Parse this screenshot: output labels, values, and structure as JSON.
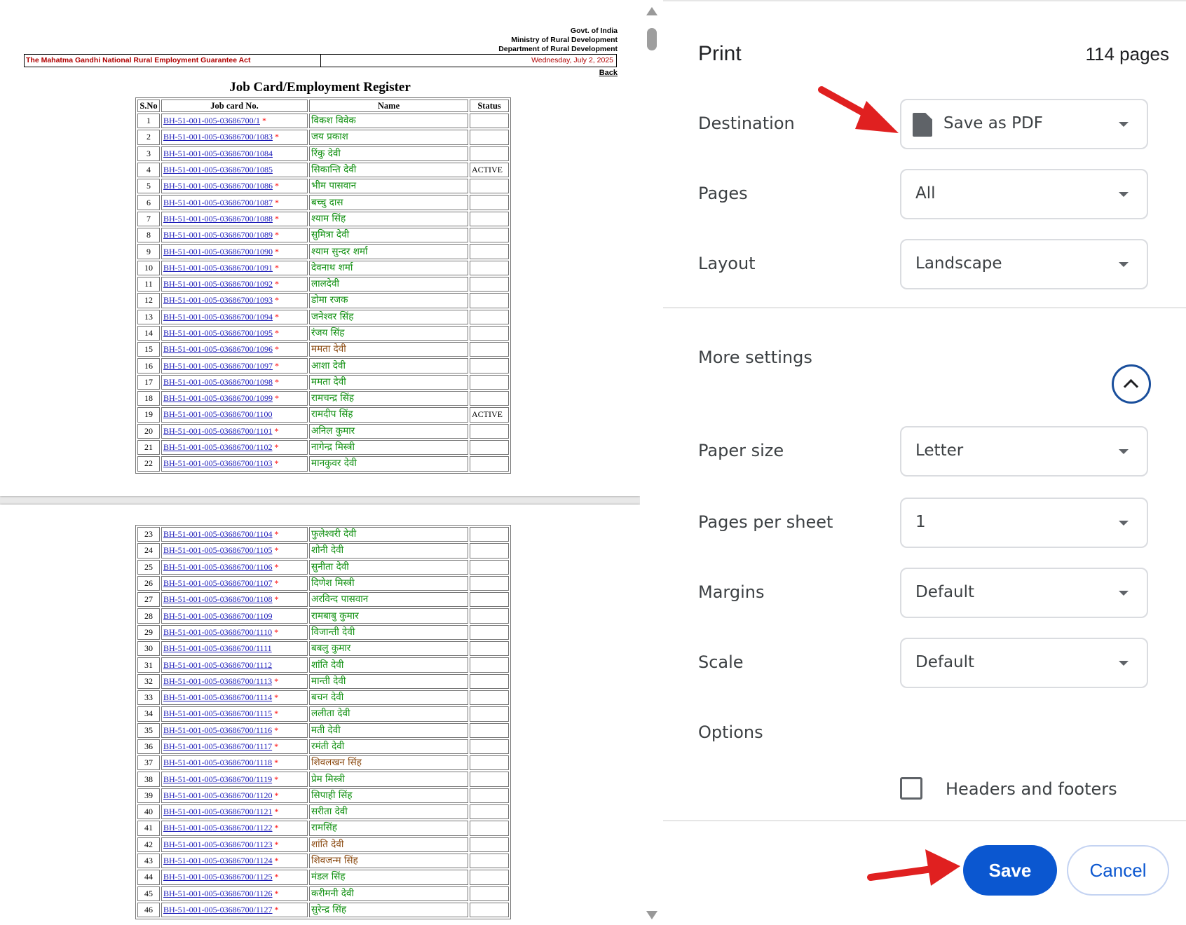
{
  "preview": {
    "header": {
      "line1": "Govt. of India",
      "line2": "Ministry of Rural Development",
      "line3": "Department of Rural Development",
      "act_name": "The Mahatma Gandhi National Rural Employment Guarantee Act",
      "date": "Wednesday, July 2, 2025",
      "back": "Back"
    },
    "register_title": "Job Card/Employment Register",
    "columns": [
      "S.No",
      "Job card No.",
      "Name",
      "Status"
    ],
    "rows": [
      {
        "sno": "1",
        "job_card": "BH-51-001-005-03686700/1",
        "star": true,
        "name": "विकश विवेक",
        "status": ""
      },
      {
        "sno": "2",
        "job_card": "BH-51-001-005-03686700/1083",
        "star": true,
        "name": "जय प्रकाश",
        "status": ""
      },
      {
        "sno": "3",
        "job_card": "BH-51-001-005-03686700/1084",
        "star": false,
        "name": "रिंकु देवी",
        "status": ""
      },
      {
        "sno": "4",
        "job_card": "BH-51-001-005-03686700/1085",
        "star": false,
        "name": "सिकान्ति देवी",
        "status": "ACTIVE"
      },
      {
        "sno": "5",
        "job_card": "BH-51-001-005-03686700/1086",
        "star": true,
        "name": "भीम पासवान",
        "status": ""
      },
      {
        "sno": "6",
        "job_card": "BH-51-001-005-03686700/1087",
        "star": true,
        "name": "बच्चु दास",
        "status": ""
      },
      {
        "sno": "7",
        "job_card": "BH-51-001-005-03686700/1088",
        "star": true,
        "name": "श्याम सिंह",
        "status": ""
      },
      {
        "sno": "8",
        "job_card": "BH-51-001-005-03686700/1089",
        "star": true,
        "name": "सुमित्रा देवी",
        "status": ""
      },
      {
        "sno": "9",
        "job_card": "BH-51-001-005-03686700/1090",
        "star": true,
        "name": "श्याम सुन्दर शर्मा",
        "status": ""
      },
      {
        "sno": "10",
        "job_card": "BH-51-001-005-03686700/1091",
        "star": true,
        "name": "देवनाथ शर्मा",
        "status": ""
      },
      {
        "sno": "11",
        "job_card": "BH-51-001-005-03686700/1092",
        "star": true,
        "name": "लालदेवी",
        "status": ""
      },
      {
        "sno": "12",
        "job_card": "BH-51-001-005-03686700/1093",
        "star": true,
        "name": "डोमा रजक",
        "status": ""
      },
      {
        "sno": "13",
        "job_card": "BH-51-001-005-03686700/1094",
        "star": true,
        "name": "जनेश्वर सिंह",
        "status": ""
      },
      {
        "sno": "14",
        "job_card": "BH-51-001-005-03686700/1095",
        "star": true,
        "name": "रंजय सिंह",
        "status": ""
      },
      {
        "sno": "15",
        "job_card": "BH-51-001-005-03686700/1096",
        "star": true,
        "name": "ममता देवी",
        "status": ""
      },
      {
        "sno": "16",
        "job_card": "BH-51-001-005-03686700/1097",
        "star": true,
        "name": "आशा देवी",
        "status": ""
      },
      {
        "sno": "17",
        "job_card": "BH-51-001-005-03686700/1098",
        "star": true,
        "name": "ममता देवी",
        "status": ""
      },
      {
        "sno": "18",
        "job_card": "BH-51-001-005-03686700/1099",
        "star": true,
        "name": "रामचन्द्र सिंह",
        "status": ""
      },
      {
        "sno": "19",
        "job_card": "BH-51-001-005-03686700/1100",
        "star": false,
        "name": "रामदीप सिंह",
        "status": "ACTIVE"
      },
      {
        "sno": "20",
        "job_card": "BH-51-001-005-03686700/1101",
        "star": true,
        "name": "अनिल कुमार",
        "status": ""
      },
      {
        "sno": "21",
        "job_card": "BH-51-001-005-03686700/1102",
        "star": true,
        "name": "नागेन्द्र मिस्त्री",
        "status": ""
      },
      {
        "sno": "22",
        "job_card": "BH-51-001-005-03686700/1103",
        "star": true,
        "name": "मानकुवर देवी",
        "status": ""
      },
      {
        "sno": "23",
        "job_card": "BH-51-001-005-03686700/1104",
        "star": true,
        "name": "फुलेश्वरी देवी",
        "status": ""
      },
      {
        "sno": "24",
        "job_card": "BH-51-001-005-03686700/1105",
        "star": true,
        "name": "शोनी देवी",
        "status": ""
      },
      {
        "sno": "25",
        "job_card": "BH-51-001-005-03686700/1106",
        "star": true,
        "name": "सुनीता देवी",
        "status": ""
      },
      {
        "sno": "26",
        "job_card": "BH-51-001-005-03686700/1107",
        "star": true,
        "name": "दिणेश मिस्त्री",
        "status": ""
      },
      {
        "sno": "27",
        "job_card": "BH-51-001-005-03686700/1108",
        "star": true,
        "name": "अरविन्द पासवान",
        "status": ""
      },
      {
        "sno": "28",
        "job_card": "BH-51-001-005-03686700/1109",
        "star": false,
        "name": "रामबाबु कुमार",
        "status": ""
      },
      {
        "sno": "29",
        "job_card": "BH-51-001-005-03686700/1110",
        "star": true,
        "name": "विजान्ती देवी",
        "status": ""
      },
      {
        "sno": "30",
        "job_card": "BH-51-001-005-03686700/1111",
        "star": false,
        "name": "बबलु कुमार",
        "status": ""
      },
      {
        "sno": "31",
        "job_card": "BH-51-001-005-03686700/1112",
        "star": false,
        "name": "शांति देवी",
        "status": ""
      },
      {
        "sno": "32",
        "job_card": "BH-51-001-005-03686700/1113",
        "star": true,
        "name": "मान्ती देवी",
        "status": ""
      },
      {
        "sno": "33",
        "job_card": "BH-51-001-005-03686700/1114",
        "star": true,
        "name": "बचन देवी",
        "status": ""
      },
      {
        "sno": "34",
        "job_card": "BH-51-001-005-03686700/1115",
        "star": true,
        "name": "ललीता देवी",
        "status": ""
      },
      {
        "sno": "35",
        "job_card": "BH-51-001-005-03686700/1116",
        "star": true,
        "name": "मती देवी",
        "status": ""
      },
      {
        "sno": "36",
        "job_card": "BH-51-001-005-03686700/1117",
        "star": true,
        "name": "रमंती देवी",
        "status": ""
      },
      {
        "sno": "37",
        "job_card": "BH-51-001-005-03686700/1118",
        "star": true,
        "name": "शिवलखन सिंह",
        "status": ""
      },
      {
        "sno": "38",
        "job_card": "BH-51-001-005-03686700/1119",
        "star": true,
        "name": "प्रेम मिस्त्री",
        "status": ""
      },
      {
        "sno": "39",
        "job_card": "BH-51-001-005-03686700/1120",
        "star": true,
        "name": "सिपाही सिंह",
        "status": ""
      },
      {
        "sno": "40",
        "job_card": "BH-51-001-005-03686700/1121",
        "star": true,
        "name": "सरीता देवी",
        "status": ""
      },
      {
        "sno": "41",
        "job_card": "BH-51-001-005-03686700/1122",
        "star": true,
        "name": "रामसिंह",
        "status": ""
      },
      {
        "sno": "42",
        "job_card": "BH-51-001-005-03686700/1123",
        "star": true,
        "name": "शांति देवी",
        "status": ""
      },
      {
        "sno": "43",
        "job_card": "BH-51-001-005-03686700/1124",
        "star": true,
        "name": "शिवजन्म सिंह",
        "status": ""
      },
      {
        "sno": "44",
        "job_card": "BH-51-001-005-03686700/1125",
        "star": true,
        "name": "मंडल सिंह",
        "status": ""
      },
      {
        "sno": "45",
        "job_card": "BH-51-001-005-03686700/1126",
        "star": true,
        "name": "करीमनी देवी",
        "status": ""
      },
      {
        "sno": "46",
        "job_card": "BH-51-001-005-03686700/1127",
        "star": true,
        "name": "सुरेन्द्र सिंह",
        "status": ""
      }
    ],
    "page1_row_count": 22,
    "colors": {
      "link": "#1a1ab8",
      "star": "#ff0000",
      "name_green": "#109010",
      "name_brown": "#8b4b12",
      "act_red": "#b00000"
    }
  },
  "print": {
    "title": "Print",
    "page_count": "114 pages",
    "destination_label": "Destination",
    "destination_value": "Save as PDF",
    "pages_label": "Pages",
    "pages_value": "All",
    "layout_label": "Layout",
    "layout_value": "Landscape",
    "more_settings_label": "More settings",
    "paper_size_label": "Paper size",
    "paper_size_value": "Letter",
    "pages_per_sheet_label": "Pages per sheet",
    "pages_per_sheet_value": "1",
    "margins_label": "Margins",
    "margins_value": "Default",
    "scale_label": "Scale",
    "scale_value": "Default",
    "options_label": "Options",
    "headers_footers_label": "Headers and footers",
    "headers_footers_checked": false,
    "save_label": "Save",
    "cancel_label": "Cancel",
    "accent": "#0b57d0",
    "annotation_arrow_color": "#e02020"
  }
}
